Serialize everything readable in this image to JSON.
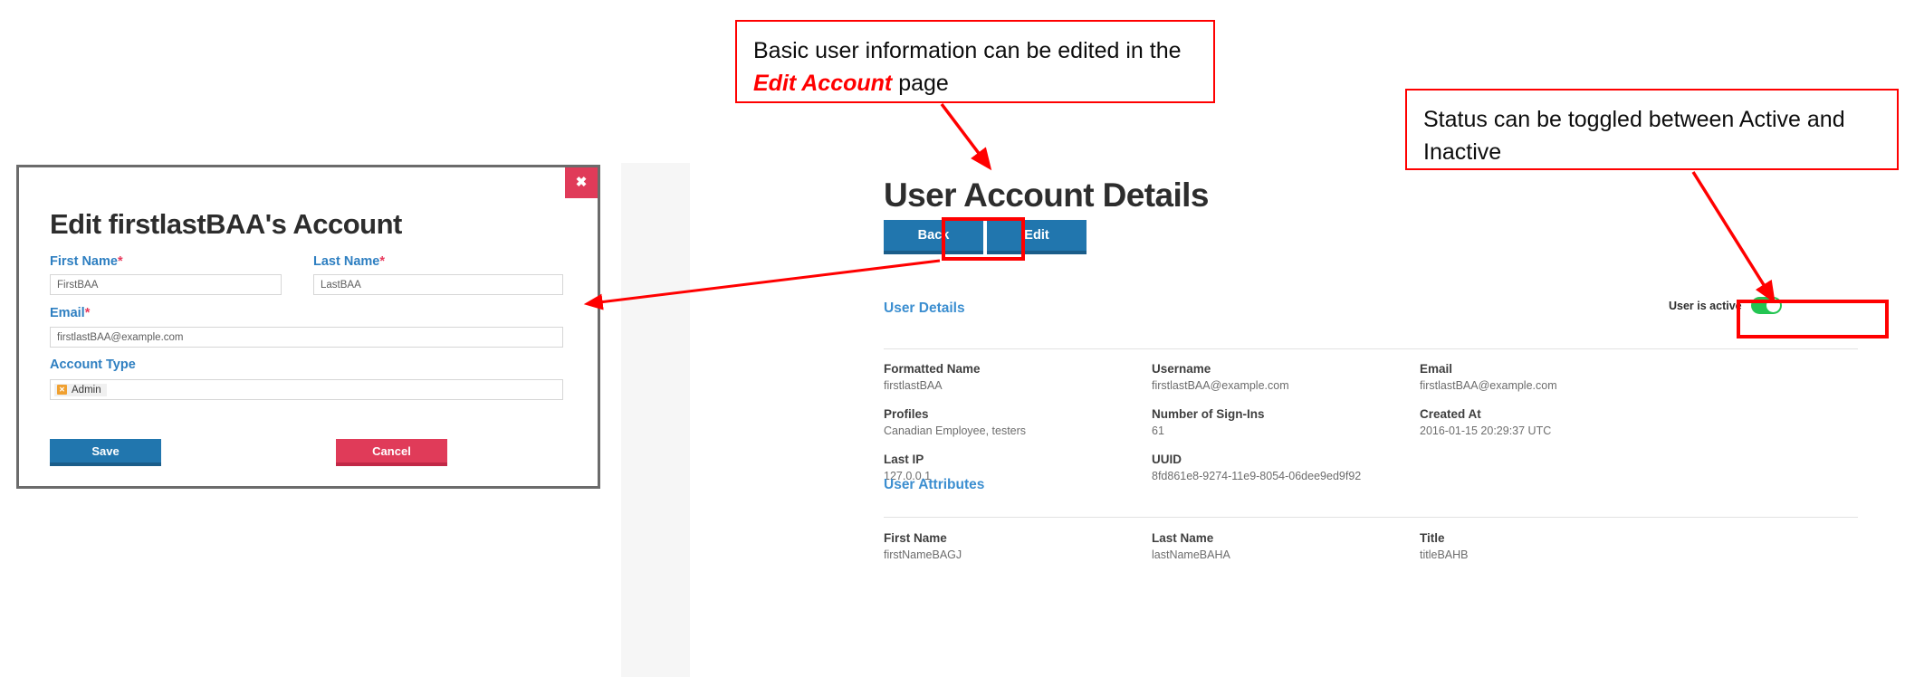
{
  "app": {
    "page_title": "User Account Details",
    "buttons": {
      "back": "Back",
      "edit": "Edit"
    },
    "status_toggle": {
      "label": "User is active",
      "state": "on",
      "color": "#23c552"
    },
    "sections": [
      {
        "heading": "User Details",
        "fields": [
          {
            "label": "Formatted Name",
            "value": "firstlastBAA"
          },
          {
            "label": "Username",
            "value": "firstlastBAA@example.com"
          },
          {
            "label": "Email",
            "value": "firstlastBAA@example.com"
          },
          {
            "label": "Profiles",
            "value": "Canadian Employee, testers"
          },
          {
            "label": "Number of Sign-Ins",
            "value": "61"
          },
          {
            "label": "Created At",
            "value": "2016-01-15 20:29:37 UTC"
          },
          {
            "label": "Last IP",
            "value": "127.0.0.1"
          },
          {
            "label": "UUID",
            "value": "8fd861e8-9274-11e9-8054-06dee9ed9f92"
          }
        ]
      },
      {
        "heading": "User Attributes",
        "fields": [
          {
            "label": "First Name",
            "value": "firstNameBAGJ"
          },
          {
            "label": "Last Name",
            "value": "lastNameBAHA"
          },
          {
            "label": "Title",
            "value": "titleBAHB"
          }
        ]
      }
    ]
  },
  "modal": {
    "title": "Edit firstlastBAA's Account",
    "close_label": "✖",
    "fields": {
      "first_name": {
        "label": "First Name",
        "required": "*",
        "value": "FirstBAA"
      },
      "last_name": {
        "label": "Last Name",
        "required": "*",
        "value": "LastBAA"
      },
      "email": {
        "label": "Email",
        "required": "*",
        "value": "firstlastBAA@example.com"
      },
      "account_type": {
        "label": "Account Type",
        "tag": "Admin",
        "tag_remove": "✕"
      }
    },
    "buttons": {
      "save": "Save",
      "cancel": "Cancel"
    }
  },
  "annotations": {
    "callout_1": {
      "text_before": "Basic user information can be edited in the ",
      "emphasis": "Edit Account",
      "text_after": " page"
    },
    "callout_2": {
      "text": "Status can be toggled between Active and Inactive"
    },
    "accent_color": "#ff0000"
  }
}
